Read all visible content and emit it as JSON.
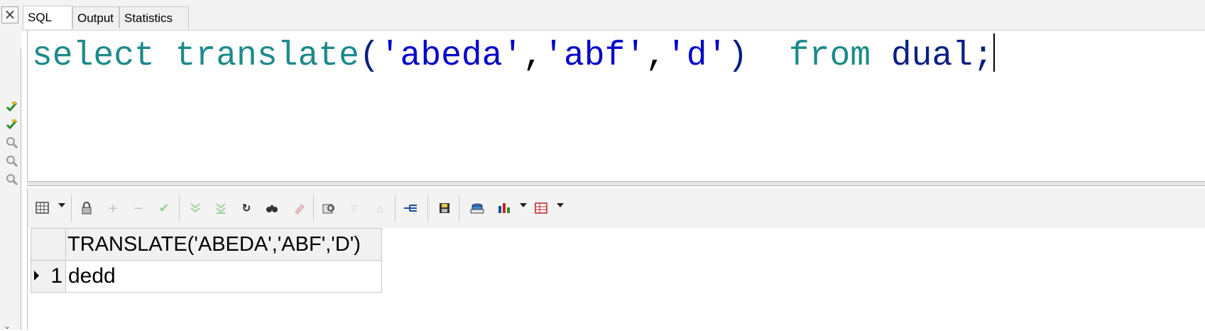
{
  "tabs": [
    {
      "label": "SQL",
      "active": true
    },
    {
      "label": "Output",
      "active": false
    },
    {
      "label": "Statistics",
      "active": false
    }
  ],
  "gutter": {
    "close_glyph": "×",
    "icons": [
      "check-pencil-icon",
      "check-pencil-icon",
      "magnifier-icon",
      "magnifier-icon",
      "magnifier-icon"
    ]
  },
  "editor": {
    "sql_text": "select translate('abeda','abf','d') from dual;",
    "tokens": {
      "select": "select",
      "translate": "translate",
      "open_paren": "(",
      "arg1": "'abeda'",
      "comma1": ",",
      "arg2": "'abf'",
      "comma2": ",",
      "arg3": "'d'",
      "close_paren": ")",
      "from": "from",
      "table": "dual",
      "semicolon": ";"
    },
    "colors": {
      "keyword": "#1d8a8a",
      "string": "#0000c8",
      "identifier": "#0b1f82"
    }
  },
  "toolbar": {
    "icons": [
      "grid-view-icon",
      "lock-icon",
      "add-record-icon",
      "delete-record-icon",
      "post-edit-icon",
      "fetch-next-icon",
      "fetch-last-icon",
      "refresh-icon",
      "find-icon",
      "clear-icon",
      "query-by-example-icon",
      "previous-icon",
      "next-icon",
      "explain-plan-icon",
      "save-icon",
      "export-icon",
      "chart-icon",
      "table-options-icon"
    ]
  },
  "grid": {
    "columns": [
      "TRANSLATE('ABEDA','ABF','D')"
    ],
    "rows": [
      {
        "num": "1",
        "cells": [
          "dedd"
        ]
      }
    ]
  }
}
